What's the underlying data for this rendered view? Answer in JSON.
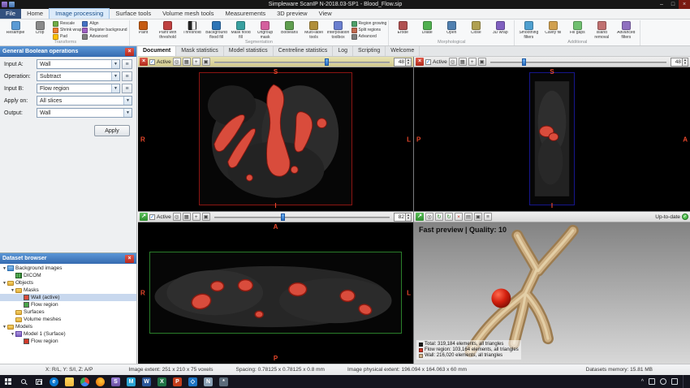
{
  "colors": {
    "accent_blue": "#2f7fd6",
    "panel_header_blue": "#3f7ec2",
    "mask_red": "#d94c3c",
    "flow_region_green": "#4aa54a",
    "model_flow_red": "#d03a2a",
    "model_wall_tan": "#d2b48c",
    "status_green": "#3dbb3d",
    "close_red": "#d23b2e"
  },
  "title_bar": {
    "title": "Simpleware ScanIP N-2018.03-SP1 - Blood_Flow.sip",
    "minimize": "–",
    "maximize": "□",
    "close": "×"
  },
  "ribbon_tabs": {
    "items": [
      "File",
      "Home",
      "Image processing",
      "Surface tools",
      "Volume mesh tools",
      "Measurements",
      "3D preview",
      "View"
    ],
    "active": "Image processing"
  },
  "ribbon": {
    "groups": [
      {
        "label": "Transforms",
        "large": [
          {
            "label": "Resample",
            "icon": "resample-icon"
          },
          {
            "label": "Crop",
            "icon": "crop-icon"
          }
        ],
        "small": [
          {
            "label": "Rescale"
          },
          {
            "label": "Shrink wrap"
          },
          {
            "label": "Pad"
          },
          {
            "label": "Align"
          },
          {
            "label": "Register background"
          },
          {
            "label": "Advanced"
          }
        ]
      },
      {
        "label": "Segmentation",
        "large": [
          {
            "label": "Paint",
            "icon": "paint-icon"
          },
          {
            "label": "Paint with threshold",
            "icon": "paint-threshold-icon"
          },
          {
            "label": "Threshold",
            "icon": "threshold-icon"
          },
          {
            "label": "Background flood fill",
            "icon": "background-flood-fill-icon"
          },
          {
            "label": "Mask flood fill",
            "icon": "mask-flood-fill-icon"
          },
          {
            "label": "Ungroup mask",
            "icon": "ungroup-mask-icon"
          },
          {
            "label": "Booleans",
            "icon": "booleans-icon"
          },
          {
            "label": "Multi-label tools",
            "icon": "multi-label-tools-icon"
          },
          {
            "label": "Interpolation toolbox",
            "icon": "interpolation-toolbox-icon"
          }
        ],
        "small": [
          {
            "label": "Region growing"
          },
          {
            "label": "Split regions"
          },
          {
            "label": "Advanced"
          }
        ]
      },
      {
        "label": "Morphological",
        "large": [
          {
            "label": "Erode",
            "icon": "erode-icon"
          },
          {
            "label": "Dilate",
            "icon": "dilate-icon"
          },
          {
            "label": "Open",
            "icon": "open-icon"
          },
          {
            "label": "Close",
            "icon": "close-icon"
          },
          {
            "label": "3D wrap",
            "icon": "3d-wrap-icon"
          }
        ],
        "small": []
      },
      {
        "label": "Additional",
        "large": [
          {
            "label": "Smoothing filters",
            "icon": "smoothing-filters-icon"
          },
          {
            "label": "Cavity fill",
            "icon": "cavity-fill-icon"
          },
          {
            "label": "Fill gaps",
            "icon": "fill-gaps-icon"
          },
          {
            "label": "Island removal",
            "icon": "island-removal-icon"
          },
          {
            "label": "Advanced filters",
            "icon": "advanced-filters-icon"
          }
        ],
        "small": []
      }
    ]
  },
  "boolean_panel": {
    "title": "General Boolean operations",
    "fields": [
      {
        "label": "Input A:",
        "value": "Wall"
      },
      {
        "label": "Operation:",
        "value": "Subtract"
      },
      {
        "label": "Input B:",
        "value": "Flow region"
      },
      {
        "label": "Apply on:",
        "value": "All slices"
      },
      {
        "label": "Output:",
        "value": "Wall"
      }
    ],
    "apply_label": "Apply"
  },
  "dataset_browser": {
    "title": "Dataset browser",
    "items": [
      {
        "label": "Background images"
      },
      {
        "label": "DICOM"
      },
      {
        "label": "Objects"
      },
      {
        "label": "Masks"
      },
      {
        "label": "Wall (active)",
        "color": "#d94c3c"
      },
      {
        "label": "Flow region",
        "color": "#4aa54a"
      },
      {
        "label": "Surfaces"
      },
      {
        "label": "Volume meshes"
      },
      {
        "label": "Models"
      },
      {
        "label": "Model 1 (Surface)"
      },
      {
        "label": "Flow region",
        "color": "#d03a2a"
      }
    ]
  },
  "document_tabs": [
    "Document",
    "Mask statistics",
    "Model statistics",
    "Centreline statistics",
    "Log",
    "Scripting",
    "Welcome"
  ],
  "viewports": {
    "top_left": {
      "active_label": "Active",
      "slice_value": "48",
      "slider_percent": 64,
      "orientation": {
        "top": "S",
        "left": "R",
        "right": "L",
        "bottom": "I"
      }
    },
    "top_right": {
      "active_label": "Active",
      "slice_value": "48",
      "slider_percent": 19,
      "orientation": {
        "top": "S",
        "left": "P",
        "right": "A",
        "bottom": "I"
      }
    },
    "bottom_left": {
      "active_label": "Active",
      "slice_value": "82",
      "slider_percent": 39,
      "orientation": {
        "top": "A",
        "left": "R",
        "right": "L",
        "bottom": "P"
      }
    },
    "preview_3d": {
      "caption": "Fast preview | Quality: 10",
      "status": "Up-to-date",
      "legend": [
        {
          "swatch": "#1a1a1a",
          "text": "Total: 319,184 elements, all triangles"
        },
        {
          "swatch": "#d03a2a",
          "text": "Flow region: 103,164 elements, all triangles"
        },
        {
          "swatch": "#d2b48c",
          "text": "Wall: 216,020 elements, all triangles"
        }
      ]
    }
  },
  "status_bar": {
    "axes": "X: R/L, Y: S/I, Z: A/P",
    "image_extent": "Image extent: 251 x 210 x 75 voxels",
    "spacing": "Spacing: 0.78125 x 0.78125 x 0.8 mm",
    "physical_extent": "Image physical extent: 196.094 x 164.063 x 60 mm",
    "memory": "Datasets memory: 15.81 MB"
  },
  "taskbar": {
    "icons": [
      "start",
      "search",
      "task-view",
      "edge",
      "file-explorer",
      "chrome",
      "firefox",
      "scanip",
      "mail",
      "word",
      "excel",
      "powerpoint",
      "vscode",
      "notepad",
      "settings"
    ],
    "tray_icons": [
      "tray-expand",
      "network",
      "volume",
      "notification"
    ]
  }
}
